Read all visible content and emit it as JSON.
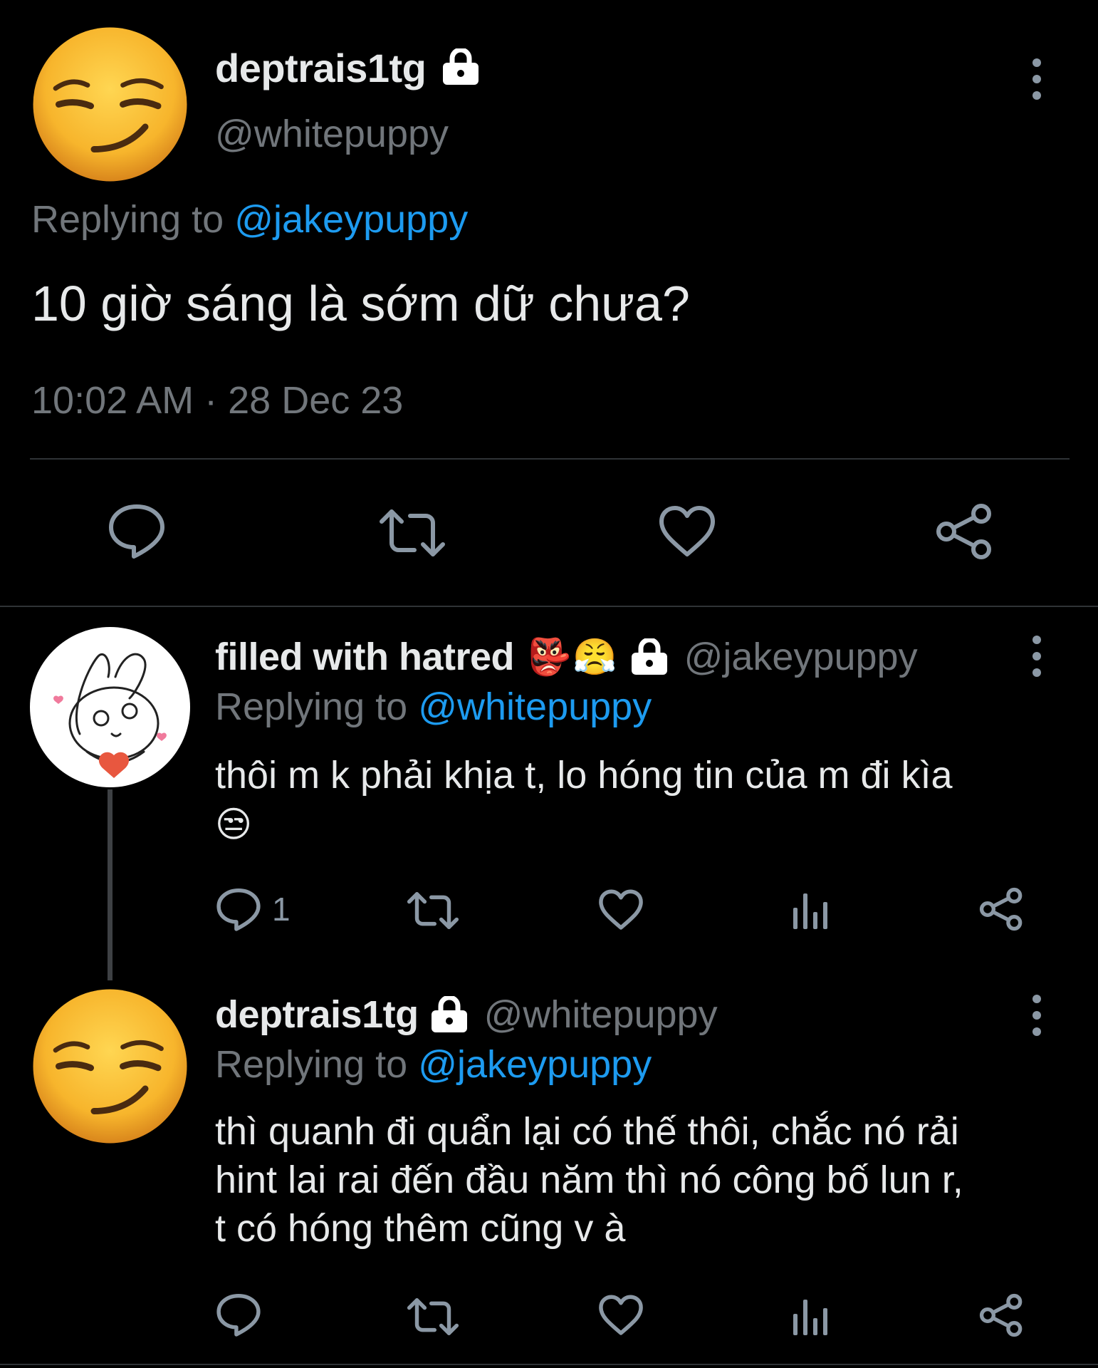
{
  "main_tweet": {
    "display_name": "deptrais1tg",
    "handle": "@whitepuppy",
    "replying_prefix": "Replying to",
    "replying_to": "@jakeypuppy",
    "text": "10 giờ sáng là sớm dữ chưa?",
    "timestamp": "10:02 AM · 28 Dec 23",
    "avatar_icon": "smirk-face-emoji",
    "actions": [
      "reply-icon",
      "retweet-icon",
      "like-icon",
      "share-icon"
    ]
  },
  "reply_1": {
    "display_name": "filled with hatred",
    "name_emojis": [
      "👺",
      "😤"
    ],
    "handle": "@jakeypuppy",
    "replying_prefix": "Replying to",
    "replying_to": "@whitepuppy",
    "text": "thôi m k phải khịa t, lo hóng tin của m đi kìa",
    "text_emoji": "😒",
    "reply_count": "1",
    "avatar_icon": "bunny-doodle-avatar"
  },
  "reply_2": {
    "display_name": "deptrais1tg",
    "handle": "@whitepuppy",
    "replying_prefix": "Replying to",
    "replying_to": "@jakeypuppy",
    "text_lines": [
      "thì quanh đi quẩn lại có thế thôi, chắc nó rải",
      "hint lai rai đến đầu năm thì nó công bố lun r,",
      "t có hóng thêm cũng v à"
    ],
    "avatar_icon": "smirk-face-emoji"
  },
  "colors": {
    "background": "#000000",
    "text": "#e7e9ea",
    "muted": "#71767b",
    "link": "#1d9bf0",
    "icon": "#8b98a5"
  }
}
